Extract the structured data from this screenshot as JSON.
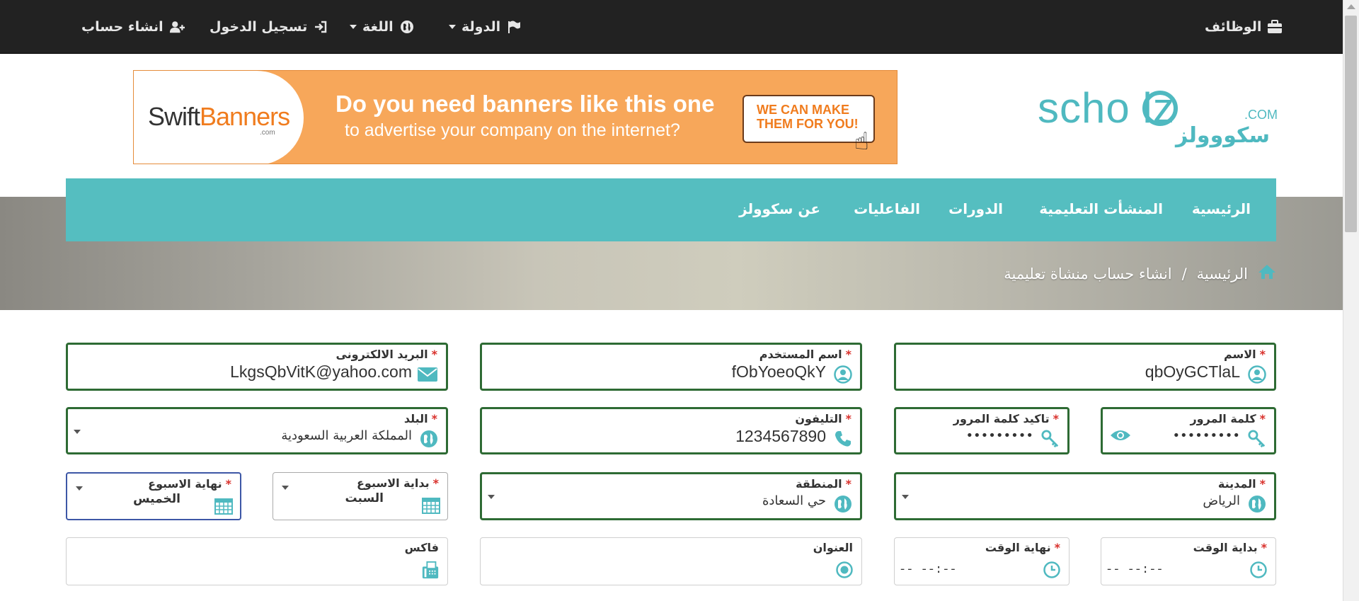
{
  "topbar": {
    "jobs": "الوظائف",
    "country": "الدولة",
    "language": "اللغة",
    "login": "تسجيل الدخول",
    "signup": "انشاء حساب"
  },
  "banner": {
    "brand_a": "Swift",
    "brand_b": "Banners",
    "brand_sub": ".com",
    "line1": "Do you need banners like this one",
    "line2": "to advertise your company on the internet?",
    "cta_1": "WE CAN MAKE",
    "cta_2": "THEM FOR YOU!"
  },
  "logo": {
    "word": "scho   lz",
    "com": ".COM",
    "ar": "سكووولز"
  },
  "nav": {
    "home": "الرئيسية",
    "institutions": "المنشأت التعليمية",
    "courses": "الدورات",
    "events": "الفاعليات",
    "about": "عن سكوولز"
  },
  "breadcrumb": {
    "home": "الرئيسية",
    "sep": "/",
    "current": "انشاء حساب منشاة تعليمية"
  },
  "form": {
    "name": {
      "label": "الاسم",
      "value": "qbOyGCTlaL"
    },
    "username": {
      "label": "اسم المستخدم",
      "value": "fObYoeoQkY"
    },
    "email": {
      "label": "البريد الالكترونى",
      "value": "LkgsQbVitK@yahoo.com"
    },
    "password": {
      "label": "كلمة المرور",
      "value": "•••••••••"
    },
    "confirm_password": {
      "label": "تاكيد كلمة المرور",
      "value": "•••••••••"
    },
    "phone": {
      "label": "التليفون",
      "value": "1234567890"
    },
    "country": {
      "label": "البلد",
      "value": "المملكة العربية السعودية"
    },
    "city": {
      "label": "المدينة",
      "value": "الرياض"
    },
    "region": {
      "label": "المنطقة",
      "value": "حي السعادة"
    },
    "week_start": {
      "label": "بداية الاسبوع",
      "value": "السبت"
    },
    "week_end": {
      "label": "نهاية الاسبوع",
      "value": "الخميس"
    },
    "start_time": {
      "label": "بداية الوقت",
      "value": "-- --:--"
    },
    "end_time": {
      "label": "نهاية الوقت",
      "value": "-- --:--"
    },
    "address": {
      "label": "العنوان",
      "value": ""
    },
    "fax": {
      "label": "فاكس",
      "value": ""
    },
    "required_mark": "*"
  },
  "colors": {
    "topbar": "#222222",
    "nav": "#55bec0",
    "field_border": "#2e6b34",
    "required": "#d9302b",
    "icon": "#4fb9c0"
  },
  "icons": {
    "jobs": "briefcase-icon",
    "country": "flag-icon",
    "language": "globe-icon",
    "login": "sign-in-icon",
    "signup": "user-plus-icon"
  }
}
